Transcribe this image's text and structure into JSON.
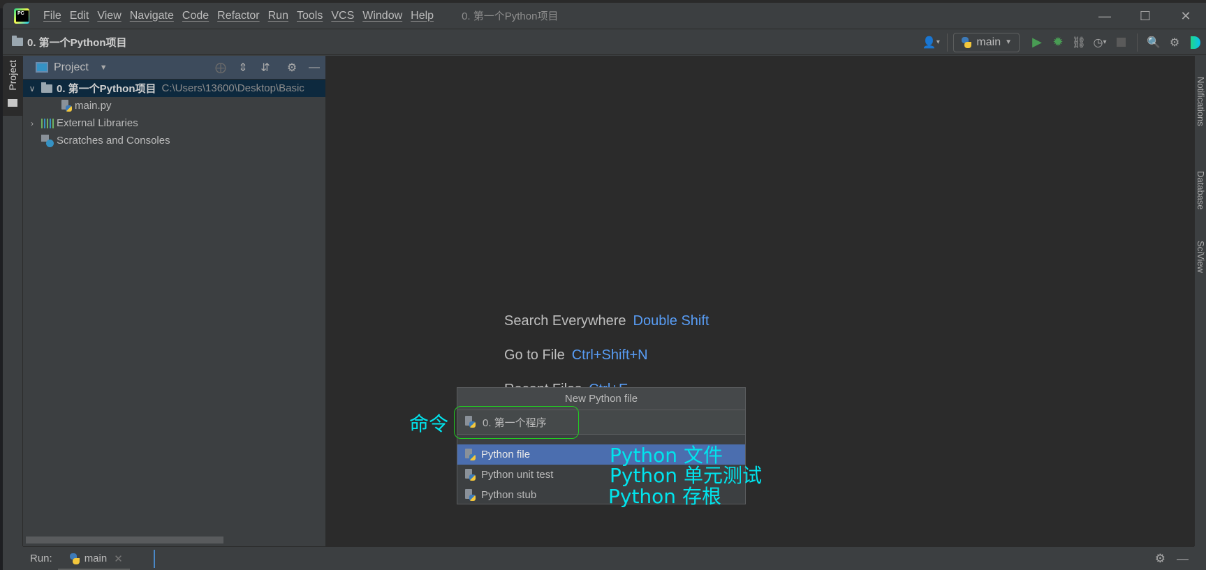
{
  "window": {
    "title": "0. 第一个Python项目",
    "controls": {
      "minimize": "—",
      "maximize": "☐",
      "close": "✕"
    }
  },
  "menu": [
    "File",
    "Edit",
    "View",
    "Navigate",
    "Code",
    "Refactor",
    "Run",
    "Tools",
    "VCS",
    "Window",
    "Help"
  ],
  "navbar": {
    "breadcrumb": "0. 第一个Python项目",
    "run_config": "main"
  },
  "left_strip": {
    "project_tab": "Project"
  },
  "project_panel": {
    "title": "Project",
    "tree": [
      {
        "label": "0. 第一个Python项目",
        "path": "C:\\Users\\13600\\Desktop\\Basic",
        "expanded": true,
        "selected": true
      },
      {
        "label": "main.py"
      },
      {
        "label": "External Libraries",
        "expanded": false
      },
      {
        "label": "Scratches and Consoles"
      }
    ]
  },
  "editor_hints": [
    {
      "label": "Search Everywhere",
      "key": "Double Shift"
    },
    {
      "label": "Go to File",
      "key": "Ctrl+Shift+N"
    },
    {
      "label": "Recent Files",
      "key": "Ctrl+E"
    }
  ],
  "popup": {
    "title": "New Python file",
    "input_value": "0. 第一个程序",
    "items": [
      {
        "label": "Python file",
        "selected": true
      },
      {
        "label": "Python unit test",
        "selected": false
      },
      {
        "label": "Python stub",
        "selected": false
      }
    ]
  },
  "annotations": {
    "command": "命令",
    "python_file": "Python 文件",
    "python_unit_test": "Python 单元测试",
    "python_stub": "Python 存根"
  },
  "right_strip": [
    "Notifications",
    "Database",
    "SciView"
  ],
  "bottom_bar": {
    "run_label": "Run:",
    "run_tab": "main"
  },
  "colors": {
    "accent_selection": "#4b6eaf",
    "link_key": "#589df6",
    "annotation": "#00e5ee",
    "annotation_box": "#22cc22",
    "run_green": "#499c54"
  }
}
